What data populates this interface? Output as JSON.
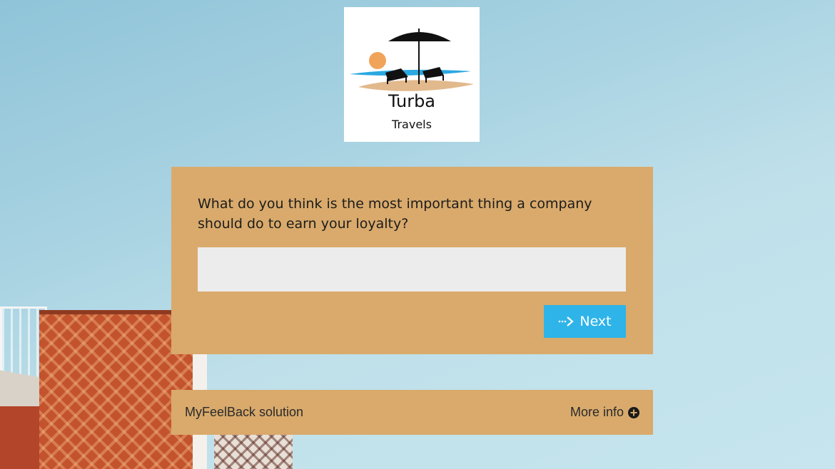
{
  "brand": {
    "name": "Turba",
    "tagline": "Travels"
  },
  "survey": {
    "question": "What do you think is the most important thing a company should do to earn your loyalty?",
    "answer_value": "",
    "next_label": "Next"
  },
  "footer": {
    "solution_label": "MyFeelBack solution",
    "more_info_label": "More info"
  },
  "icons": {
    "next": "dotted-arrow-right-icon",
    "more_info": "plus-circle-icon",
    "logo": "beach-umbrella-chairs-logo"
  },
  "colors": {
    "card_background": "#d9aa6c",
    "button_background": "#2eb4e9",
    "input_background": "#ececec",
    "logo_sun": "#f0a45a",
    "logo_water": "#2aa8e0",
    "logo_sand": "#e2b98c"
  }
}
